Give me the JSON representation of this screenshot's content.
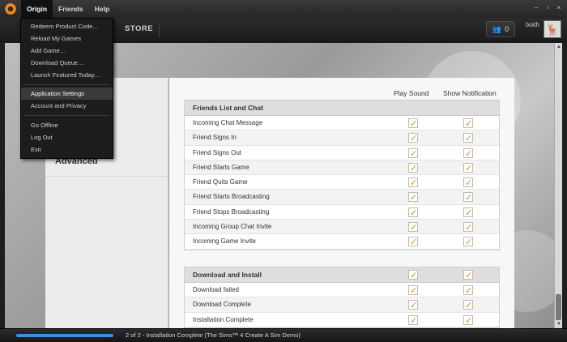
{
  "menubar": {
    "items": [
      "Origin",
      "Friends",
      "Help"
    ],
    "window_controls": [
      "–",
      "▫",
      "×"
    ]
  },
  "navbar": {
    "store_label": "STORE",
    "friends_count": "0",
    "username": "lxath"
  },
  "origin_menu": {
    "items": [
      "Redeem Product Code…",
      "Reload My Games",
      "Add Game…",
      "Download Queue…",
      "Launch Featured Today…",
      "Application Settings",
      "Account and Privacy",
      "Go Offline",
      "Log Out",
      "Exit"
    ],
    "highlighted_index": 5
  },
  "settings_nav": {
    "advanced_label": "Advanced"
  },
  "columns": {
    "play_sound": "Play Sound",
    "show_notification": "Show Notification"
  },
  "sections": [
    {
      "title": "Friends List and Chat",
      "title_checks": false,
      "rows": [
        {
          "label": "Incoming Chat Message",
          "sound": true,
          "notify": true
        },
        {
          "label": "Friend Signs In",
          "sound": true,
          "notify": true
        },
        {
          "label": "Friend Signs Out",
          "sound": true,
          "notify": true
        },
        {
          "label": "Friend Starts Game",
          "sound": true,
          "notify": true
        },
        {
          "label": "Friend Quits Game",
          "sound": true,
          "notify": true
        },
        {
          "label": "Friend Starts Broadcasting",
          "sound": true,
          "notify": true
        },
        {
          "label": "Friend Stops Broadcasting",
          "sound": true,
          "notify": true
        },
        {
          "label": "Incoming Group Chat Invite",
          "sound": true,
          "notify": true
        },
        {
          "label": "Incoming Game Invite",
          "sound": true,
          "notify": true
        }
      ]
    },
    {
      "title": "Download and Install",
      "title_checks": true,
      "rows": [
        {
          "label": "Download failed",
          "sound": true,
          "notify": true
        },
        {
          "label": "Download Complete",
          "sound": true,
          "notify": true
        },
        {
          "label": "Installation Complete",
          "sound": true,
          "notify": true
        }
      ]
    }
  ],
  "statusbar": {
    "text": "2 of 2 - Installation Complete (The Sims™ 4 Create A Sim Demo)",
    "progress_percent": 100
  },
  "colors": {
    "accent_orange": "#f08a12",
    "progress_blue": "#3f8ed8"
  }
}
